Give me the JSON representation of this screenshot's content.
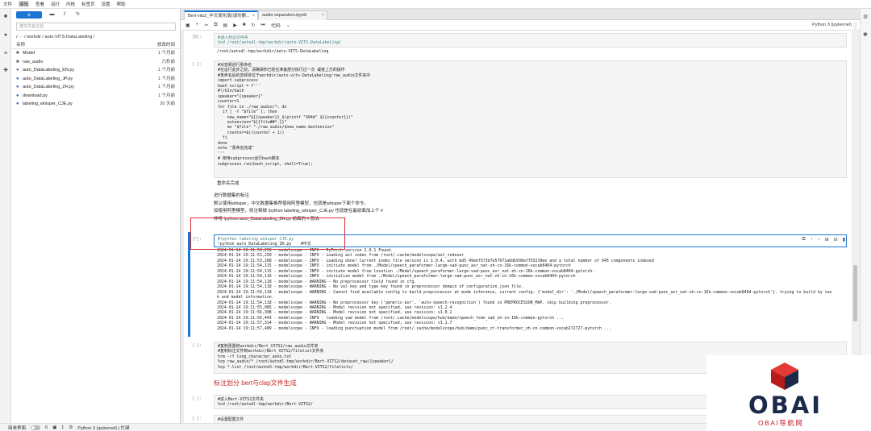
{
  "menu": [
    "文件",
    "编辑",
    "查看",
    "运行",
    "内核",
    "标签页",
    "设置",
    "帮助"
  ],
  "filebrowser": {
    "new_label": "+",
    "search_placeholder": "按文件名过滤",
    "breadcrumb": "/ ··· / workdir / auto-VITS-DataLabeling /",
    "col_name": "名称",
    "col_modified": "修改时间",
    "items": [
      {
        "icon": "folder-icon",
        "name": "Model",
        "modified": "1 个月前"
      },
      {
        "icon": "folder-icon",
        "name": "raw_audio",
        "modified": "几秒前"
      },
      {
        "icon": "python-file-icon",
        "name": "auto_DataLabeling_EN.py",
        "modified": "1 个月前"
      },
      {
        "icon": "python-file-icon",
        "name": "auto_DataLabeling_JP.py",
        "modified": "1 个月前"
      },
      {
        "icon": "python-file-icon",
        "name": "auto_DataLabeling_ZH.py",
        "modified": "1 个月前"
      },
      {
        "icon": "python-file-icon",
        "name": "download.py",
        "modified": "1 个月前"
      },
      {
        "icon": "python-file-icon",
        "name": "labeling_whisper_CJE.py",
        "modified": "20 天前"
      }
    ]
  },
  "tabs": [
    {
      "label": "Bert-vits2_中文简化版(请勿删...",
      "active": true
    },
    {
      "label": "audio separation.ipynb",
      "active": false
    }
  ],
  "toolbar": {
    "cell_type": "代码",
    "kernel": "Python 3 (ipykernel)"
  },
  "cells": {
    "c1": {
      "prompt": "[8]:",
      "code": "#进入标注文件夹\n%cd /root/autodl-tmp/workdir/auto-VITS-DataLabeling/",
      "output": "/root/autodl-tmp/workdir/auto-VITS-DataLabeling"
    },
    "c2": {
      "prompt": "[ ]:",
      "code": "#对音频进行重命名\n#在运行此步之前，请确保你已经在准备部分执行过一次 或者上方的操作\n#重命名后的音频将位于workdir/auto-vits-DataLabeling/raw_audio文件夹中\nimport subprocess\nbash_script = f'''\n#!/bin/bash\nspeaker=\"{speaker}\"\ncounter=1\nfor file in ./raw_audio/*; do\n  if [ -f \"$file\" ]; then\n    new_name=\"${{speaker}}_$(printf \"%04d\" ${{counter}})\"\n    extension=\"${{file##*.}}\"\n    mv \"$file\" \"./raw_audio/$new_name.$extension\"\n    counter=$((counter + 1))\n  fi\ndone\necho \"重命名完成\"\n'''\n# 使用subprocess运行bash脚本\nsubprocess.run(bash_script, shell=True);",
      "output": "重命名完成"
    },
    "md1": {
      "line1": "进行数据集的标注",
      "line2": "默认使用whisper，中文数据集推荐使用阿里模型，也就是whisper下面个命令。",
      "line3": "如使用阿里模型，则注释掉 !python labeling_whisper_CJE.py 也就是在最前面加上个 #",
      "line4": "并将 !python auto_DataLabeling_ZH.py 前面的 # 删去"
    },
    "c3": {
      "prompt": "[*]:",
      "code_line1": "#!python labeling_whisper_CJE.py",
      "code_line2": "!python auto_DataLabeling_ZH.py    #中文",
      "output": "2024-01-14 19:11:53,250 - modelscope - INFO - PyTorch version 2.0.1 Found.\n2024-01-14 19:11:53,250 - modelscope - INFO - Loading ast index from /root/.cache/modelscope/ast_indexer\n2024-01-14 19:11:53,288 - modelscope - INFO - Loading done! Current index file version is 1.9.4, with md5 49ebf573b7e57671a0db930ef755239ee and a total number of 945 components indexed\n2024-01-14 19:11:54,115 - modelscope - INFO - initiate model from ./Model/speech_paraformer-large-vad-punc_asr_nat-zh-cn-16k-common-vocab8404-pytorch\n2024-01-14 19:11:54,115 - modelscope - INFO - initiate model from location ./Model/speech_paraformer-large-vad-punc_asr_nat-zh-cn-16k-common-vocab8404-pytorch.\n2024-01-14 19:11:54,116 - modelscope - INFO - initialize model from ./Model/speech_paraformer-large-vad-punc_asr_nat-zh-cn-16k-common-vocab8404-pytorch\n2024-01-14 19:11:54,118 - modelscope - WARNING - No preprocessor field found in cfg.\n2024-01-14 19:11:54,118 - modelscope - WARNING - No val key and type key found in preprocessor domain of configuration.json file.\n2024-01-14 19:11:54,118 - modelscope - WARNING - Cannot find available config to build preprocessor at mode inference, current config: {'model_dir': './Model/speech_paraformer-large-vad-punc_asr_nat-zh-cn-16k-common-vocab8404-pytorch'}. trying to build by tas\nk and model information.\n2024-01-14 19:11:54,118 - modelscope - WARNING - No preprocessor key ('generic-asr', 'auto-speech-recognition') found in PREPROCESSOR_MAP, skip building preprocessor.\n2024-01-14 19:11:55,085 - modelscope - WARNING - Model revision not specified, use revision: v1.2.4\n2024-01-14 19:11:56,308 - modelscope - WARNING - Model revision not specified, use revision: v1.0.2\n2024-01-14 19:11:56,443 - modelscope - INFO - loading vad model from /root/.cache/modelscope/hub/damo/speech_fsmn_vad_zh-cn-16k-common-pytorch ...\n2024-01-14 19:11:57,314 - modelscope - WARNING - Model revision not specified, use revision: v1.1.7\n2024-01-14 19:11:57,489 - modelscope - INFO - loading punctuation model from /root/.cache/modelscope/hub/damo/punc_ct-transformer_zh-cn-common-vocab272727-pytorch ..."
    },
    "c4": {
      "prompt": "[ ]:",
      "code": "#复制重置的workdir/Bert_VITS2/raw_audio文件夹\n#复制标注文件到workdir/Bert_VITS2/filelist文件夹\n%rm -rf long_character_anno.txt\n%cp raw_audio/* /root/autodl-tmp/workdir/Bert-VITS2/dataset_raw/{speaker}/\n%cp *.list /root/autodl-tmp/workdir/Bert-VITS2/filelists/"
    },
    "md2": {
      "text": "标注划分 bert与clap文件生成"
    },
    "c5": {
      "prompt": "[ ]:",
      "code": "#进入Bert-VITS2文件夹\n%cd /root/autodl-tmp/workdir/Bert-VITS2/"
    },
    "c6": {
      "prompt": "[ ]:",
      "code": "#设置配置文件"
    }
  },
  "status": {
    "mode": "简单界面",
    "count1": "0",
    "count2": "1",
    "kernel": "Python 3 (ipykernel) | 忙碌"
  },
  "watermark": {
    "logo": "OBAI",
    "sub": "OBAI导航网",
    "colors": {
      "red": "#c8202a",
      "navy": "#1b2a4a"
    }
  }
}
